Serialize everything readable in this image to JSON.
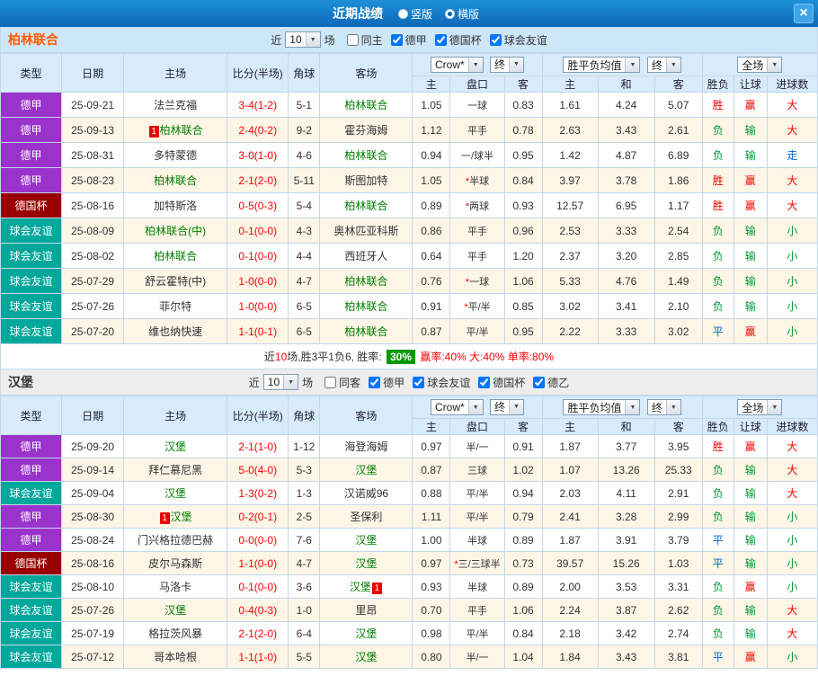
{
  "topbar": {
    "title": "近期战绩",
    "options": [
      {
        "label": "竖版",
        "selected": false
      },
      {
        "label": "横版",
        "selected": true
      }
    ],
    "close_label": "×"
  },
  "columns": {
    "type": "类型",
    "date": "日期",
    "home": "主场",
    "score": "比分(半场)",
    "corner": "角球",
    "away": "客场",
    "odds_company": "Crow*",
    "final_a": "终",
    "wdl_avg": "胜平负均值",
    "final_b": "终",
    "fulltime": "全场",
    "odds_home": "主",
    "handicap": "盘口",
    "odds_away": "客",
    "avg_win": "主",
    "avg_draw": "和",
    "avg_lose": "客",
    "result": "胜负",
    "handicap_result": "让球",
    "goals": "进球数"
  },
  "filter_labels": {
    "near": "近",
    "count": "10",
    "matches": "场"
  },
  "type_colors": {
    "德甲": "#9933cc",
    "德国杯": "#990000",
    "球会友谊": "#00a79b",
    "德乙": "#3366cc"
  },
  "result_colors": {
    "胜": "#ff0000",
    "赢": "#ff0000",
    "大": "#ff0000",
    "负": "#009933",
    "输": "#009933",
    "小": "#009933",
    "平": "#0066cc",
    "走": "#0066cc"
  },
  "sections": [
    {
      "team": "柏林联合",
      "filters": [
        {
          "label": "同主",
          "checked": false
        },
        {
          "label": "德甲",
          "checked": true
        },
        {
          "label": "德国杯",
          "checked": true
        },
        {
          "label": "球会友谊",
          "checked": true
        }
      ],
      "rows": [
        {
          "type": "德甲",
          "date": "25-09-21",
          "home": "法兰克福",
          "homeSub": false,
          "homeBadge": "",
          "score": "3-4(1-2)",
          "corner": "5-1",
          "away": "柏林联合",
          "awaySub": true,
          "awayBadge": "",
          "oddsH": "1.05",
          "hcap": "一球",
          "oddsA": "0.83",
          "avgW": "1.61",
          "avgD": "4.24",
          "avgL": "5.07",
          "res": "胜",
          "hres": "赢",
          "goals": "大"
        },
        {
          "type": "德甲",
          "date": "25-09-13",
          "home": "柏林联合",
          "homeSub": true,
          "homeBadge": "1",
          "score": "2-4(0-2)",
          "corner": "9-2",
          "away": "霍芬海姆",
          "awaySub": false,
          "awayBadge": "",
          "oddsH": "1.12",
          "hcap": "平手",
          "oddsA": "0.78",
          "avgW": "2.63",
          "avgD": "3.43",
          "avgL": "2.61",
          "res": "负",
          "hres": "输",
          "goals": "大"
        },
        {
          "type": "德甲",
          "date": "25-08-31",
          "home": "多特蒙德",
          "homeSub": false,
          "homeBadge": "",
          "score": "3-0(1-0)",
          "corner": "4-6",
          "away": "柏林联合",
          "awaySub": true,
          "awayBadge": "",
          "oddsH": "0.94",
          "hcap": "一/球半",
          "oddsA": "0.95",
          "avgW": "1.42",
          "avgD": "4.87",
          "avgL": "6.89",
          "res": "负",
          "hres": "输",
          "goals": "走"
        },
        {
          "type": "德甲",
          "date": "25-08-23",
          "home": "柏林联合",
          "homeSub": true,
          "homeBadge": "",
          "score": "2-1(2-0)",
          "corner": "5-11",
          "away": "斯图加特",
          "awaySub": false,
          "awayBadge": "",
          "oddsH": "1.05",
          "hcap": "*半球",
          "oddsA": "0.84",
          "avgW": "3.97",
          "avgD": "3.78",
          "avgL": "1.86",
          "res": "胜",
          "hres": "赢",
          "goals": "大"
        },
        {
          "type": "德国杯",
          "date": "25-08-16",
          "home": "加特斯洛",
          "homeSub": false,
          "homeBadge": "",
          "score": "0-5(0-3)",
          "corner": "5-4",
          "away": "柏林联合",
          "awaySub": true,
          "awayBadge": "",
          "oddsH": "0.89",
          "hcap": "*两球",
          "oddsA": "0.93",
          "avgW": "12.57",
          "avgD": "6.95",
          "avgL": "1.17",
          "res": "胜",
          "hres": "赢",
          "goals": "大"
        },
        {
          "type": "球会友谊",
          "date": "25-08-09",
          "home": "柏林联合(中)",
          "homeSub": true,
          "homeBadge": "",
          "score": "0-1(0-0)",
          "corner": "4-3",
          "away": "奥林匹亚科斯",
          "awaySub": false,
          "awayBadge": "",
          "oddsH": "0.86",
          "hcap": "平手",
          "oddsA": "0.96",
          "avgW": "2.53",
          "avgD": "3.33",
          "avgL": "2.54",
          "res": "负",
          "hres": "输",
          "goals": "小"
        },
        {
          "type": "球会友谊",
          "date": "25-08-02",
          "home": "柏林联合",
          "homeSub": true,
          "homeBadge": "",
          "score": "0-1(0-0)",
          "corner": "4-4",
          "away": "西班牙人",
          "awaySub": false,
          "awayBadge": "",
          "oddsH": "0.64",
          "hcap": "平手",
          "oddsA": "1.20",
          "avgW": "2.37",
          "avgD": "3.20",
          "avgL": "2.85",
          "res": "负",
          "hres": "输",
          "goals": "小"
        },
        {
          "type": "球会友谊",
          "date": "25-07-29",
          "home": "舒云霍特(中)",
          "homeSub": false,
          "homeBadge": "",
          "score": "1-0(0-0)",
          "corner": "4-7",
          "away": "柏林联合",
          "awaySub": true,
          "awayBadge": "",
          "oddsH": "0.76",
          "hcap": "*一球",
          "oddsA": "1.06",
          "avgW": "5.33",
          "avgD": "4.76",
          "avgL": "1.49",
          "res": "负",
          "hres": "输",
          "goals": "小"
        },
        {
          "type": "球会友谊",
          "date": "25-07-26",
          "home": "菲尔特",
          "homeSub": false,
          "homeBadge": "",
          "score": "1-0(0-0)",
          "corner": "6-5",
          "away": "柏林联合",
          "awaySub": true,
          "awayBadge": "",
          "oddsH": "0.91",
          "hcap": "*平/半",
          "oddsA": "0.85",
          "avgW": "3.02",
          "avgD": "3.41",
          "avgL": "2.10",
          "res": "负",
          "hres": "输",
          "goals": "小"
        },
        {
          "type": "球会友谊",
          "date": "25-07-20",
          "home": "维也纳快速",
          "homeSub": false,
          "homeBadge": "",
          "score": "1-1(0-1)",
          "corner": "6-5",
          "away": "柏林联合",
          "awaySub": true,
          "awayBadge": "",
          "oddsH": "0.87",
          "hcap": "平/半",
          "oddsA": "0.95",
          "avgW": "2.22",
          "avgD": "3.33",
          "avgL": "3.02",
          "res": "平",
          "hres": "赢",
          "goals": "小"
        }
      ],
      "summary": [
        {
          "text": "近",
          "style": "dark"
        },
        {
          "text": "10",
          "style": "red"
        },
        {
          "text": "场,胜3平1负6, 胜率: ",
          "style": "dark"
        },
        {
          "text": "30%",
          "style": "highlight"
        },
        {
          "text": " 赢率:40%",
          "style": "red"
        },
        {
          "text": " 大:40%",
          "style": "red"
        },
        {
          "text": " 单率:80%",
          "style": "red"
        }
      ]
    },
    {
      "team": "汉堡",
      "filters": [
        {
          "label": "同客",
          "checked": false
        },
        {
          "label": "德甲",
          "checked": true
        },
        {
          "label": "球会友谊",
          "checked": true
        },
        {
          "label": "德国杯",
          "checked": true
        },
        {
          "label": "德乙",
          "checked": true
        }
      ],
      "rows": [
        {
          "type": "德甲",
          "date": "25-09-20",
          "home": "汉堡",
          "homeSub": true,
          "homeBadge": "",
          "score": "2-1(1-0)",
          "corner": "1-12",
          "away": "海登海姆",
          "awaySub": false,
          "awayBadge": "",
          "oddsH": "0.97",
          "hcap": "半/一",
          "oddsA": "0.91",
          "avgW": "1.87",
          "avgD": "3.77",
          "avgL": "3.95",
          "res": "胜",
          "hres": "赢",
          "goals": "大"
        },
        {
          "type": "德甲",
          "date": "25-09-14",
          "home": "拜仁慕尼黑",
          "homeSub": false,
          "homeBadge": "",
          "score": "5-0(4-0)",
          "corner": "5-3",
          "away": "汉堡",
          "awaySub": true,
          "awayBadge": "",
          "oddsH": "0.87",
          "hcap": "三球",
          "oddsA": "1.02",
          "avgW": "1.07",
          "avgD": "13.26",
          "avgL": "25.33",
          "res": "负",
          "hres": "输",
          "goals": "大"
        },
        {
          "type": "球会友谊",
          "date": "25-09-04",
          "home": "汉堡",
          "homeSub": true,
          "homeBadge": "",
          "score": "1-3(0-2)",
          "corner": "1-3",
          "away": "汉诺威96",
          "awaySub": false,
          "awayBadge": "",
          "oddsH": "0.88",
          "hcap": "平/半",
          "oddsA": "0.94",
          "avgW": "2.03",
          "avgD": "4.11",
          "avgL": "2.91",
          "res": "负",
          "hres": "输",
          "goals": "大"
        },
        {
          "type": "德甲",
          "date": "25-08-30",
          "home": "汉堡",
          "homeSub": true,
          "homeBadge": "1",
          "score": "0-2(0-1)",
          "corner": "2-5",
          "away": "圣保利",
          "awaySub": false,
          "awayBadge": "",
          "oddsH": "1.11",
          "hcap": "平/半",
          "oddsA": "0.79",
          "avgW": "2.41",
          "avgD": "3.28",
          "avgL": "2.99",
          "res": "负",
          "hres": "输",
          "goals": "小"
        },
        {
          "type": "德甲",
          "date": "25-08-24",
          "home": "门兴格拉德巴赫",
          "homeSub": false,
          "homeBadge": "",
          "score": "0-0(0-0)",
          "corner": "7-6",
          "away": "汉堡",
          "awaySub": true,
          "awayBadge": "",
          "oddsH": "1.00",
          "hcap": "半球",
          "oddsA": "0.89",
          "avgW": "1.87",
          "avgD": "3.91",
          "avgL": "3.79",
          "res": "平",
          "hres": "输",
          "goals": "小"
        },
        {
          "type": "德国杯",
          "date": "25-08-16",
          "home": "皮尔马森斯",
          "homeSub": false,
          "homeBadge": "",
          "score": "1-1(0-0)",
          "corner": "4-7",
          "away": "汉堡",
          "awaySub": true,
          "awayBadge": "",
          "oddsH": "0.97",
          "hcap": "*三/三球半",
          "oddsA": "0.73",
          "avgW": "39.57",
          "avgD": "15.26",
          "avgL": "1.03",
          "res": "平",
          "hres": "输",
          "goals": "小"
        },
        {
          "type": "球会友谊",
          "date": "25-08-10",
          "home": "马洛卡",
          "homeSub": false,
          "homeBadge": "",
          "score": "0-1(0-0)",
          "corner": "3-6",
          "away": "汉堡",
          "awaySub": true,
          "awayBadge": "1",
          "oddsH": "0.93",
          "hcap": "半球",
          "oddsA": "0.89",
          "avgW": "2.00",
          "avgD": "3.53",
          "avgL": "3.31",
          "res": "负",
          "hres": "赢",
          "goals": "小"
        },
        {
          "type": "球会友谊",
          "date": "25-07-26",
          "home": "汉堡",
          "homeSub": true,
          "homeBadge": "",
          "score": "0-4(0-3)",
          "corner": "1-0",
          "away": "里昂",
          "awaySub": false,
          "awayBadge": "",
          "oddsH": "0.70",
          "hcap": "平手",
          "oddsA": "1.06",
          "avgW": "2.24",
          "avgD": "3.87",
          "avgL": "2.62",
          "res": "负",
          "hres": "输",
          "goals": "大"
        },
        {
          "type": "球会友谊",
          "date": "25-07-19",
          "home": "格拉茨风暴",
          "homeSub": false,
          "homeBadge": "",
          "score": "2-1(2-0)",
          "corner": "6-4",
          "away": "汉堡",
          "awaySub": true,
          "awayBadge": "",
          "oddsH": "0.98",
          "hcap": "平/半",
          "oddsA": "0.84",
          "avgW": "2.18",
          "avgD": "3.42",
          "avgL": "2.74",
          "res": "负",
          "hres": "输",
          "goals": "大"
        },
        {
          "type": "球会友谊",
          "date": "25-07-12",
          "home": "哥本哈根",
          "homeSub": false,
          "homeBadge": "",
          "score": "1-1(1-0)",
          "corner": "5-5",
          "away": "汉堡",
          "awaySub": true,
          "awayBadge": "",
          "oddsH": "0.80",
          "hcap": "半/一",
          "oddsA": "1.04",
          "avgW": "1.84",
          "avgD": "3.43",
          "avgL": "3.81",
          "res": "平",
          "hres": "赢",
          "goals": "小"
        }
      ]
    }
  ]
}
